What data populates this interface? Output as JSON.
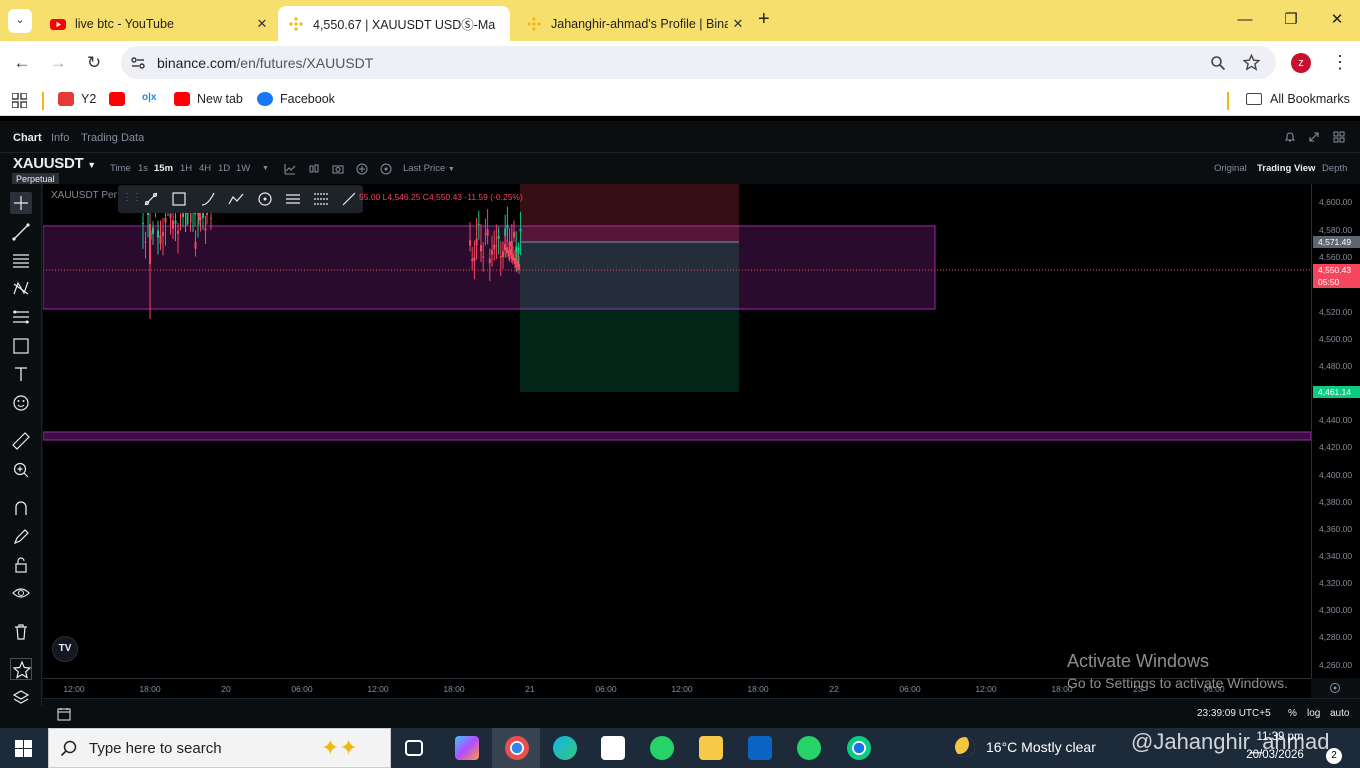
{
  "browser": {
    "tabs": [
      {
        "title": "live btc - YouTube",
        "active": false
      },
      {
        "title": "4,550.67 | XAUUSDT USDⓈ-Ma",
        "active": true
      },
      {
        "title": "Jahanghir-ahmad's Profile | Bina",
        "active": false
      }
    ],
    "new_tab": "+",
    "url_host": "binance.com",
    "url_path": "/en/futures/XAUUSDT",
    "profile_initial": "z",
    "bookmarks": [
      "Y2",
      "",
      "",
      "New tab",
      "Facebook"
    ],
    "all_bookmarks": "All Bookmarks"
  },
  "colors": {
    "tabbar": "#f7df6e",
    "up": "#0ecb81",
    "down": "#f6465d",
    "box_purple": "#9c27b0"
  },
  "app": {
    "tabs": [
      "Chart",
      "Info",
      "Trading Data"
    ],
    "symbol": "XAUUSDT",
    "contract": "Perpetual",
    "timeframes": [
      "Time",
      "1s",
      "15m",
      "1H",
      "4H",
      "1D",
      "1W"
    ],
    "active_timeframe": "15m",
    "price_type": "Last Price",
    "views": [
      "Original",
      "Trading View",
      "Depth"
    ],
    "active_view": "Trading View",
    "legend": "XAUUSDT Per",
    "ohlc": "55.00  L4,546.25  C4,550.43  -11.59 (-0.25%)",
    "price_axis": [
      "4,600.00",
      "4,580.00",
      "4,560.00",
      "4,520.00",
      "4,500.00",
      "4,480.00",
      "4,440.00",
      "4,420.00",
      "4,400.00",
      "4,380.00",
      "4,360.00",
      "4,340.00",
      "4,320.00",
      "4,300.00",
      "4,280.00",
      "4,260.00"
    ],
    "price_tags": {
      "gray": "4,571.49",
      "last": "4,550.43",
      "countdown": "05:50",
      "target": "4,461.14"
    },
    "time_axis": [
      "12:00",
      "18:00",
      "20",
      "06:00",
      "12:00",
      "18:00",
      "21",
      "06:00",
      "12:00",
      "18:00",
      "22",
      "06:00",
      "12:00",
      "18:00",
      "23",
      "06:00"
    ],
    "bottom": {
      "clock": "23:39:09 UTC+5",
      "percent": "%",
      "log": "log",
      "auto": "auto"
    },
    "activate_line1": "Activate Windows",
    "activate_line2": "Go to Settings to activate Windows."
  },
  "taskbar": {
    "search_placeholder": "Type here to search",
    "weather": "16°C  Mostly clear",
    "time": "11:39 pm",
    "date": "20/03/2026",
    "notifications": "2",
    "watermark": "@Jahanghir_ahmad"
  }
}
